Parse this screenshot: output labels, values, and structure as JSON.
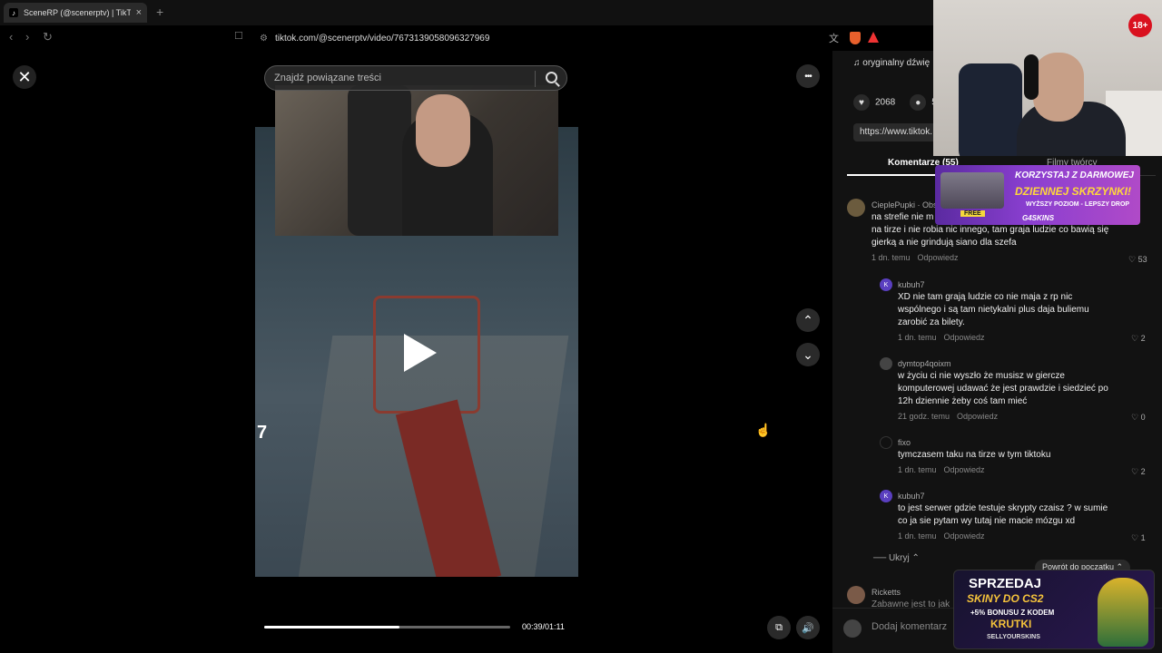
{
  "browser": {
    "tab_title": "SceneRP (@scenerptv) | TikTok",
    "tab_favicon": "tiktok-icon",
    "tab_close": "×",
    "new_tab": "+",
    "back": "‹",
    "forward": "›",
    "reload": "↻",
    "bookmark": "☐",
    "url": "tiktok.com/@scenerptv/video/7673139058096327969"
  },
  "player": {
    "close": "✕",
    "search_placeholder": "Znajdź powiązane treści",
    "overlay_number": "7",
    "time": "00:39/01:11",
    "progress_fraction": 0.55,
    "more": "•••",
    "prev": "⌃",
    "next": "⌄",
    "pip": "⧉",
    "volume": "🔊"
  },
  "panel": {
    "sound": "♫  oryginalny dźwię",
    "likes": "2068",
    "comments_count": "5",
    "link": "https://www.tiktok.",
    "tab_comments": "Komentarze (55)",
    "tab_creator": "Filmy twórcy",
    "comments": [
      {
        "user": "CieplePupki · Obs",
        "text_lines": [
          "na strefie nie m",
          "na tirze i nie robia nic innego, tam graja ludzie co bawią się",
          "gierką a nie grindują siano dla szefa"
        ],
        "time": "1 dn. temu",
        "reply": "Odpowiedz",
        "likes": "53"
      },
      {
        "user": "kubuh7",
        "text_lines": [
          "XD nie tam grają ludzie co nie maja z rp nic",
          "wspólnego i są tam nietykalni plus daja buliemu",
          "zarobić za bilety."
        ],
        "time": "1 dn. temu",
        "reply": "Odpowiedz",
        "likes": "2"
      },
      {
        "user": "dymtop4qoixm",
        "text_lines": [
          "w życiu ci nie wyszło że musisz w giercze",
          "komputerowej udawać że jest prawdzie i siedzieć po",
          "12h dziennie żeby coś tam mieć"
        ],
        "time": "21 godz. temu",
        "reply": "Odpowiedz",
        "likes": "0"
      },
      {
        "user": "fixo",
        "text_lines": [
          "tymczasem taku na tirze w tym tiktoku"
        ],
        "time": "1 dn. temu",
        "reply": "Odpowiedz",
        "likes": "2"
      },
      {
        "user": "kubuh7",
        "text_lines": [
          "to jest serwer gdzie testuje skrypty czaisz ? w sumie",
          "co ja sie pytam wy tutaj nie macie mózgu xd"
        ],
        "time": "1 dn. temu",
        "reply": "Odpowiedz",
        "likes": "1"
      }
    ],
    "hide": "Ukryj ⌃",
    "back_to_top": "Powrót do początku ⌃",
    "next_user": "Ricketts",
    "next_text": "Zabawne jest to jak",
    "add_comment": "Dodaj komentarz"
  },
  "overlay": {
    "age_badge": "18+",
    "ad1_line1": "KORZYSTAJ Z DARMOWEJ",
    "ad1_line2": "DZIENNEJ SKRZYNKI!",
    "ad1_line3": "WYŻSZY POZIOM - LEPSZY DROP",
    "ad1_free": "FREE",
    "ad1_brand": "G4SKINS",
    "ad2_line1": "SPRZEDAJ",
    "ad2_line2": "SKINY DO CS2",
    "ad2_line3": "+5% BONUSU Z KODEM",
    "ad2_code": "KRUTKI",
    "ad2_brand": "SELLYOURSKINS"
  }
}
